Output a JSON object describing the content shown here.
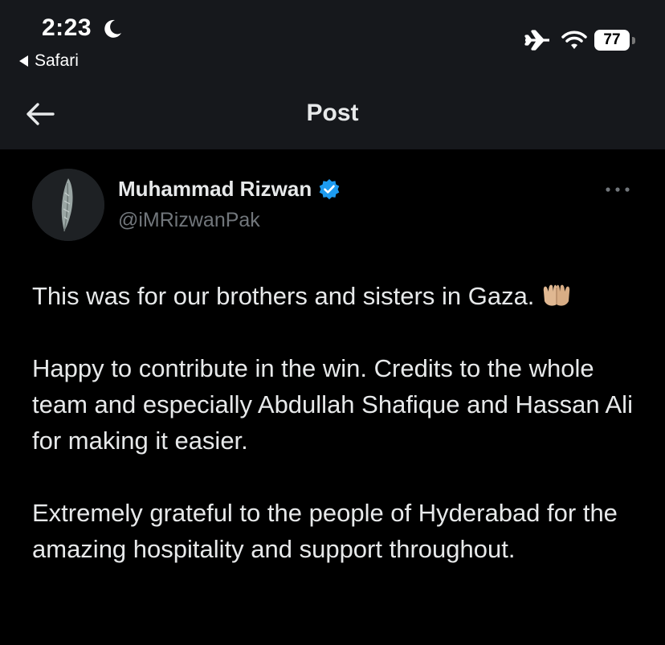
{
  "status_bar": {
    "time": "2:23",
    "back_app": "Safari",
    "battery": "77",
    "icons": [
      "moon-icon",
      "airplane-icon",
      "wifi-icon",
      "battery-icon"
    ]
  },
  "nav": {
    "title": "Post"
  },
  "tweet": {
    "author_name": "Muhammad Rizwan",
    "handle": "@iMRizwanPak",
    "paragraphs": [
      "This was for our brothers and sisters in Gaza.",
      "Happy to contribute in the win. Credits to the whole team and especially Abdullah Shafique and Hassan Ali for making it easier.",
      "Extremely grateful to the people of Hyderabad for the amazing hospitality and support throughout."
    ],
    "emoji": "palms-up-together-icon"
  },
  "colors": {
    "background": "#000000",
    "bar_background": "#16181c",
    "text": "#e7e9ea",
    "muted": "#71767b",
    "verified_blue": "#1d9bf0"
  }
}
